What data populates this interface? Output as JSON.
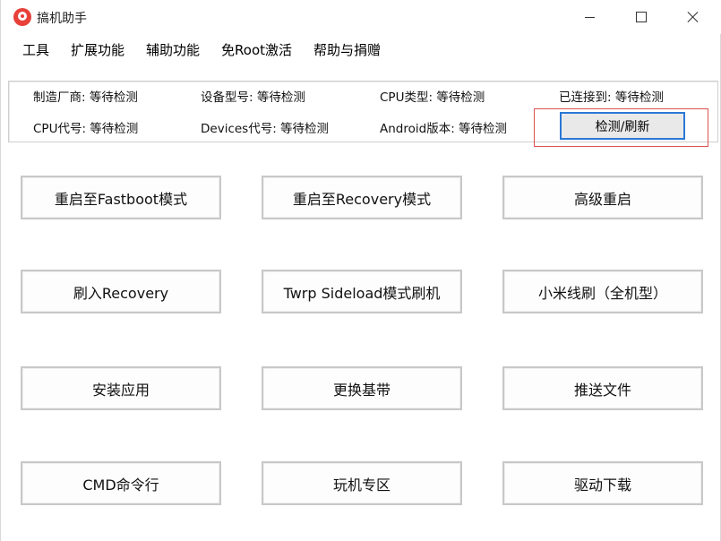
{
  "window": {
    "title": "搞机助手"
  },
  "menu": [
    "工具",
    "扩展功能",
    "辅助功能",
    "免Root激活",
    "帮助与捐赠"
  ],
  "info": {
    "manufacturer": "制造厂商: 等待检测",
    "device_model": "设备型号: 等待检测",
    "cpu_type": "CPU类型: 等待检测",
    "connected_to": "已连接到: 等待检测",
    "cpu_code": "CPU代号: 等待检测",
    "devices_code": "Devices代号: 等待检测",
    "android_version": "Android版本: 等待检测",
    "refresh_button": "检测/刷新"
  },
  "actions": {
    "reboot_fastboot": "重启至Fastboot模式",
    "reboot_recovery": "重启至Recovery模式",
    "advanced_reboot": "高级重启",
    "flash_recovery": "刷入Recovery",
    "twrp_sideload": "Twrp Sideload模式刷机",
    "xiaomi_line_flash": "小米线刷（全机型）",
    "install_app": "安装应用",
    "replace_baseband": "更换基带",
    "push_file": "推送文件",
    "cmd": "CMD命令行",
    "fun_zone": "玩机专区",
    "driver_download": "驱动下载"
  }
}
